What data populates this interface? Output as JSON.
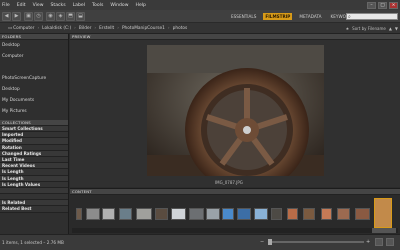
{
  "menubar": {
    "items": [
      "File",
      "Edit",
      "View",
      "Stacks",
      "Label",
      "Tools",
      "Window",
      "Help"
    ],
    "minimize": "–",
    "maximize": "□",
    "close": "×"
  },
  "workspaces": {
    "items": [
      "ESSENTIALS",
      "FILMSTRIP",
      "METADATA",
      "KEYWORDS"
    ],
    "active_index": 1
  },
  "search": {
    "placeholder": ""
  },
  "path": {
    "crumbs": [
      "Computer",
      "Lokaldisk (C:)",
      "Bilder",
      "Erstellt",
      "PhotoManipCourse1",
      "photos"
    ]
  },
  "sort": {
    "label": "Sort by Filename",
    "up": "▲",
    "down": "▼"
  },
  "panels": {
    "folders_title": "FOLDERS",
    "folders": [
      "Desktop",
      "Computer",
      "",
      "PhotoScreenCapture",
      "Desktop",
      "My Documents",
      "My Pictures",
      "",
      "",
      ""
    ],
    "collections_title": "COLLECTIONS",
    "collections": [
      "Smart Collections",
      "Imported",
      "Modified",
      "Rotation",
      "Changed Ratings",
      "Last Time",
      "Recent Videos",
      "Is Length",
      "Is Length",
      "Is Length Values",
      "",
      "",
      "Is Related",
      "Related Best"
    ]
  },
  "preview": {
    "title": "PREVIEW",
    "caption": "IMG_0787.JPG"
  },
  "content": {
    "title": "CONTENT"
  },
  "status": {
    "text": "1 items, 1 selected – 2.76 MB"
  },
  "colors": {
    "accent": "#d89b18",
    "bg": "#2b2b2b",
    "panel": "#2f2f2f"
  }
}
